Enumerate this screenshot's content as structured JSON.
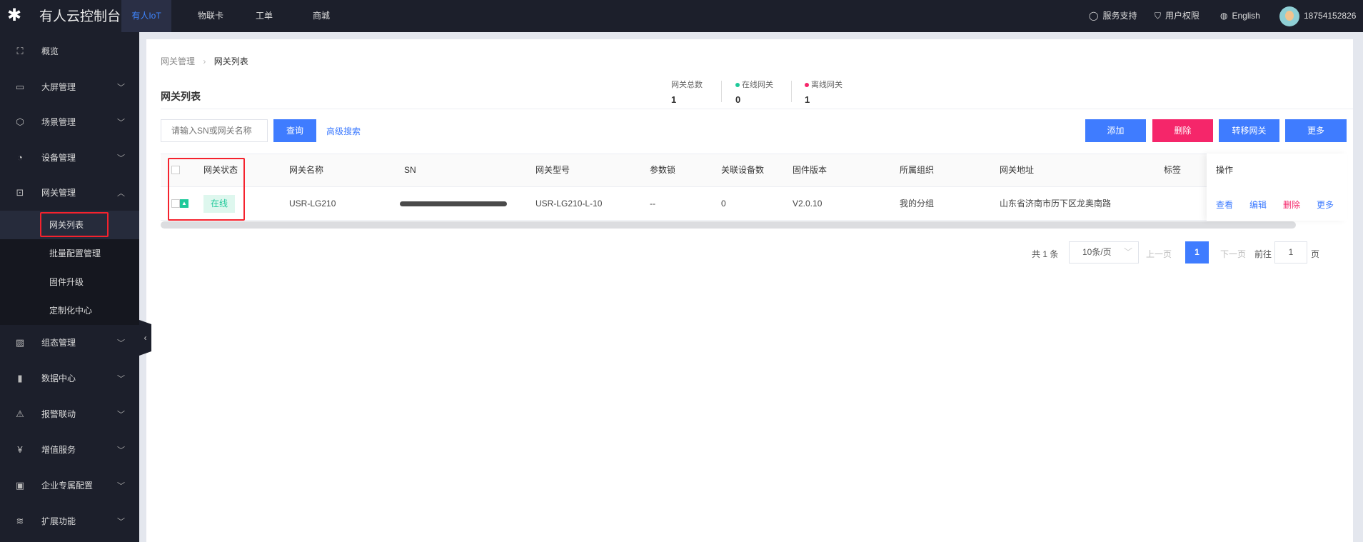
{
  "app": {
    "title": "有人云控制台",
    "logo_icon": "person-logo-icon"
  },
  "topnav": {
    "tabs": [
      {
        "label": "有人IoT",
        "active": true
      },
      {
        "label": "物联卡"
      },
      {
        "label": "工单"
      },
      {
        "label": "商城"
      }
    ],
    "support": "服务支持",
    "permissions": "用户权限",
    "language": "English",
    "user": "18754152826"
  },
  "sidebar": {
    "items": [
      {
        "label": "概览",
        "icon": "overview-icon"
      },
      {
        "label": "大屏管理",
        "icon": "screen-icon"
      },
      {
        "label": "场景管理",
        "icon": "cube-icon"
      },
      {
        "label": "设备管理",
        "icon": "pie-icon"
      },
      {
        "label": "网关管理",
        "icon": "gateway-icon"
      },
      {
        "label": "组态管理",
        "icon": "image-icon"
      },
      {
        "label": "数据中心",
        "icon": "bar-chart-icon"
      },
      {
        "label": "报警联动",
        "icon": "alarm-icon"
      },
      {
        "label": "增值服务",
        "icon": "yen-icon"
      },
      {
        "label": "企业专属配置",
        "icon": "code-monitor-icon"
      },
      {
        "label": "扩展功能",
        "icon": "layers-icon"
      }
    ],
    "sub_items": [
      "网关列表",
      "批量配置管理",
      "固件升级",
      "定制化中心"
    ]
  },
  "breadcrumb": {
    "parent": "网关管理",
    "current": "网关列表"
  },
  "page_title": "网关列表",
  "stats": {
    "total_label": "网关总数",
    "total": "1",
    "online_label": "在线网关",
    "online": "0",
    "offline_label": "离线网关",
    "offline": "1",
    "online_color": "#1fc99a",
    "offline_color": "#f5266a"
  },
  "search": {
    "placeholder": "请输入SN或网关名称",
    "query": "查询",
    "advanced": "高级搜索"
  },
  "actions": {
    "add": "添加",
    "delete": "删除",
    "transfer": "转移网关",
    "more": "更多"
  },
  "table": {
    "headers": [
      "网关状态",
      "网关名称",
      "SN",
      "网关型号",
      "参数锁",
      "关联设备数",
      "固件版本",
      "所属组织",
      "网关地址",
      "标签",
      "操作"
    ],
    "rows": [
      {
        "status": "在线",
        "name": "USR-LG210",
        "model": "USR-LG210-L-10",
        "lock": "--",
        "devices": "0",
        "firmware": "V2.0.10",
        "org": "我的分组",
        "address": "山东省济南市历下区龙奥南路",
        "tag": "",
        "ops": [
          "查看",
          "编辑",
          "删除",
          "更多"
        ]
      }
    ]
  },
  "pagination": {
    "total": "共 1 条",
    "page_size": "10条/页",
    "prev": "上一页",
    "page": "1",
    "next": "下一页",
    "goto": "前往",
    "goto_value": "1",
    "page_suffix": "页"
  }
}
